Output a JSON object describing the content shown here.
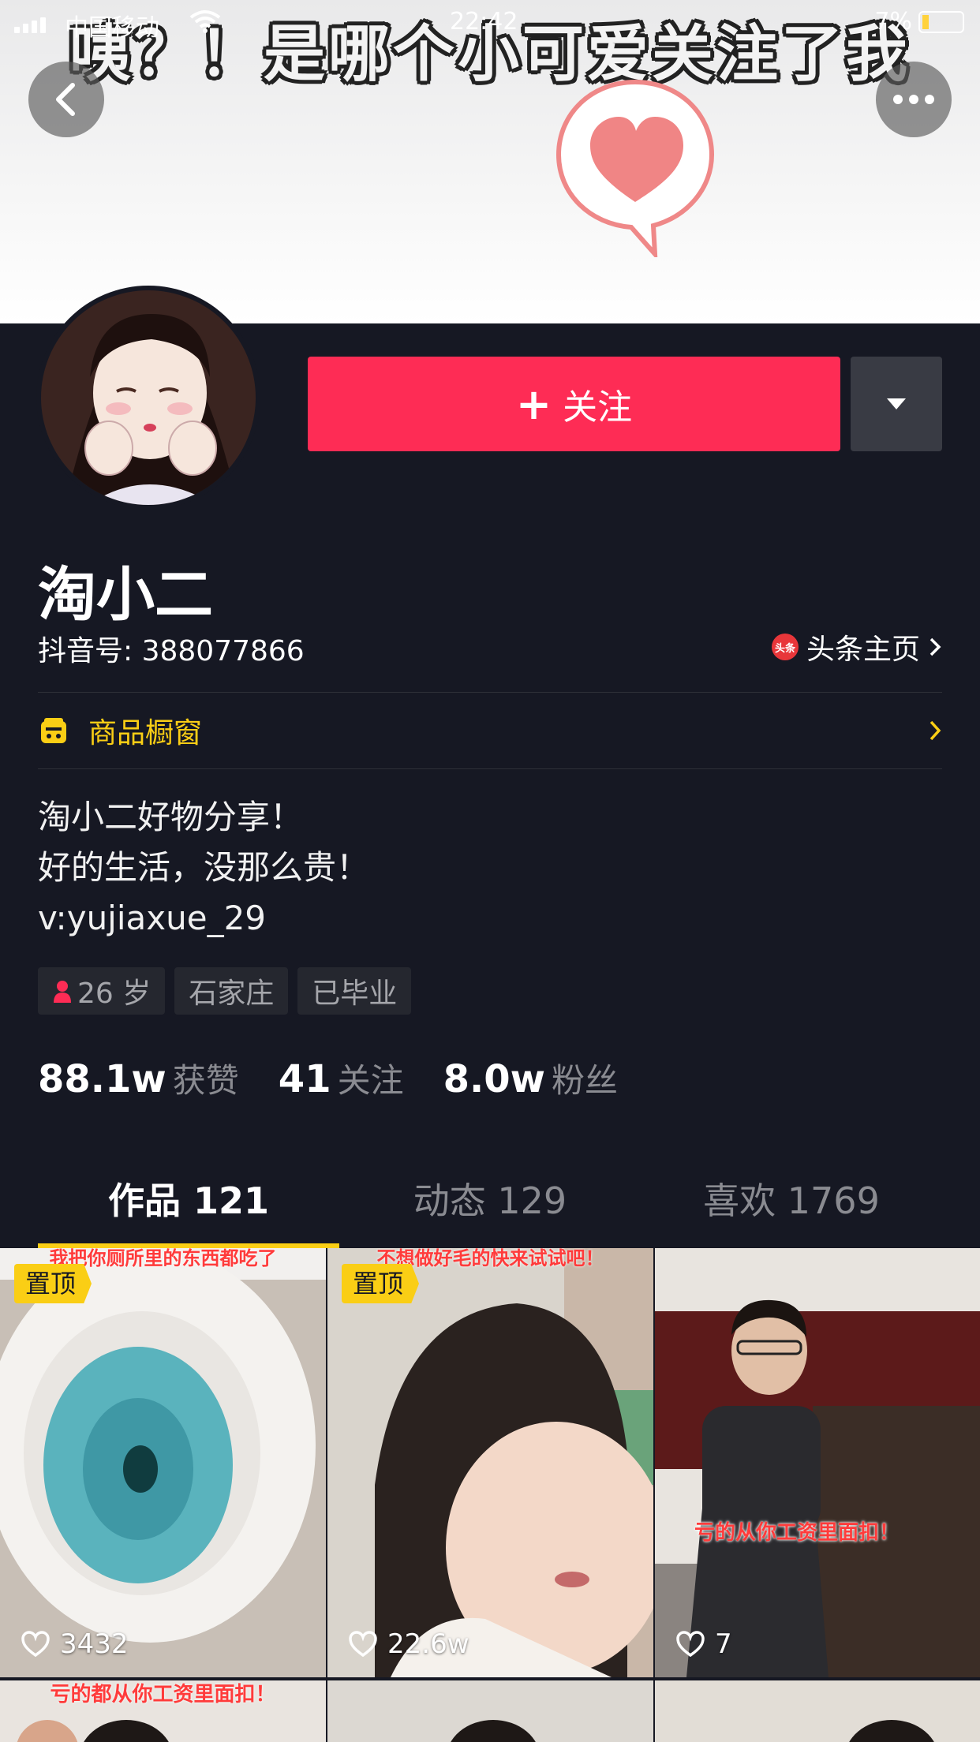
{
  "status_bar": {
    "carrier": "中国移动",
    "time": "22:42",
    "battery": "7%"
  },
  "banner": {
    "text": "咦？！是哪个小可爱关注了我"
  },
  "actions": {
    "follow_label": "关注",
    "follow_plus": "+"
  },
  "profile": {
    "nickname": "淘小二",
    "douyin_id": "抖音号: 388077866",
    "toutiao_badge": "头条",
    "toutiao_label": "头条主页",
    "shop_label": "商品橱窗",
    "bio": [
      "淘小二好物分享！",
      "好的生活，没那么贵！",
      "v:yujiaxue_29"
    ],
    "tags": [
      "26 岁",
      "石家庄",
      "已毕业"
    ]
  },
  "stats": [
    {
      "value": "88.1w",
      "label": "获赞"
    },
    {
      "value": "41",
      "label": "关注"
    },
    {
      "value": "8.0w",
      "label": "粉丝"
    }
  ],
  "tabs": [
    {
      "label": "作品 121",
      "active": true
    },
    {
      "label": "动态 129",
      "active": false
    },
    {
      "label": "喜欢 1769",
      "active": false
    }
  ],
  "videos": [
    {
      "pinned": "置顶",
      "likes": "3432",
      "caption": "我把你厕所里的东西都吃了"
    },
    {
      "pinned": "置顶",
      "likes": "22.6w",
      "caption": "不想做好毛的快来试试吧！"
    },
    {
      "likes": "7",
      "caption": "亏的从你工资里面扣！"
    }
  ],
  "second_row": {
    "caption": "亏的都从你工资里面扣！"
  },
  "colors": {
    "background": "#161823",
    "follow": "#fe2c55",
    "accent": "#face15"
  }
}
